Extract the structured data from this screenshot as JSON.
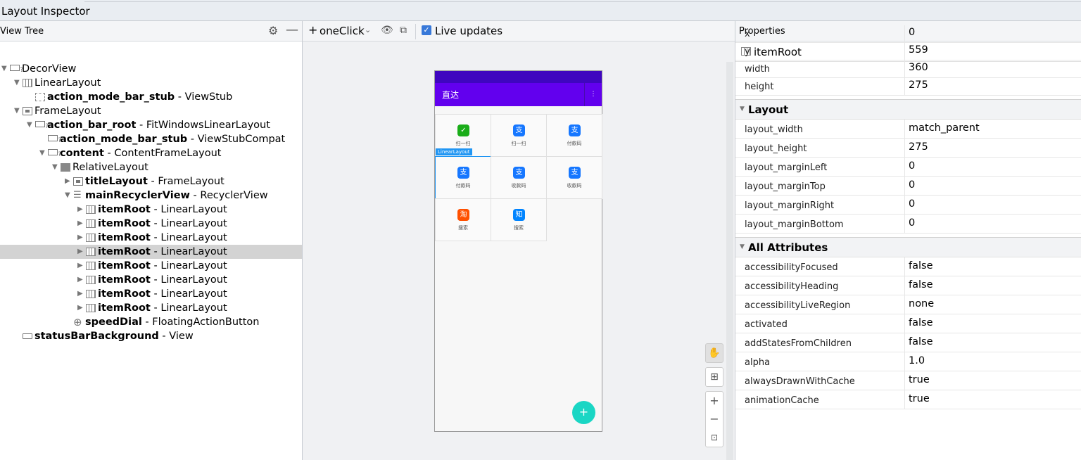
{
  "window": {
    "title": "Layout Inspector"
  },
  "view_tree": {
    "header": "View Tree",
    "gear_icon": "gear-icon",
    "minimize_icon": "minimize-icon",
    "nodes": [
      {
        "id": "",
        "cls": "DecorView"
      },
      {
        "id": "",
        "cls": "LinearLayout"
      },
      {
        "id": "action_mode_bar_stub",
        "cls": "ViewStub"
      },
      {
        "id": "",
        "cls": "FrameLayout"
      },
      {
        "id": "action_bar_root",
        "cls": "FitWindowsLinearLayout"
      },
      {
        "id": "action_mode_bar_stub",
        "cls": "ViewStubCompat"
      },
      {
        "id": "content",
        "cls": "ContentFrameLayout"
      },
      {
        "id": "",
        "cls": "RelativeLayout"
      },
      {
        "id": "titleLayout",
        "cls": "FrameLayout"
      },
      {
        "id": "mainRecyclerView",
        "cls": "RecyclerView"
      },
      {
        "id": "itemRoot",
        "cls": "LinearLayout"
      },
      {
        "id": "itemRoot",
        "cls": "LinearLayout"
      },
      {
        "id": "itemRoot",
        "cls": "LinearLayout"
      },
      {
        "id": "itemRoot",
        "cls": "LinearLayout"
      },
      {
        "id": "itemRoot",
        "cls": "LinearLayout"
      },
      {
        "id": "itemRoot",
        "cls": "LinearLayout"
      },
      {
        "id": "itemRoot",
        "cls": "LinearLayout"
      },
      {
        "id": "itemRoot",
        "cls": "LinearLayout"
      },
      {
        "id": "speedDial",
        "cls": "FloatingActionButton"
      },
      {
        "id": "statusBarBackground",
        "cls": "View"
      }
    ],
    "separator": " - "
  },
  "toolbar": {
    "plus": "+",
    "process": "oneClick",
    "dropdown": "⌄",
    "live_updates": "Live updates",
    "checkmark": "✓"
  },
  "device": {
    "app_title": "直达",
    "menu": "⋮",
    "selected_tag": "LinearLayout",
    "fab": "+",
    "cells": [
      {
        "icon": "✓",
        "caption": "扫一扫",
        "color": "#1aad19"
      },
      {
        "icon": "支",
        "caption": "扫一扫",
        "color": "#1677ff"
      },
      {
        "icon": "支",
        "caption": "付款码",
        "color": "#1677ff"
      },
      {
        "icon": "支",
        "caption": "付款码",
        "color": "#1677ff"
      },
      {
        "icon": "支",
        "caption": "收款码",
        "color": "#1677ff"
      },
      {
        "icon": "支",
        "caption": "收款码",
        "color": "#1677ff"
      },
      {
        "icon": "淘",
        "caption": "搜索",
        "color": "#ff5000"
      },
      {
        "icon": "知",
        "caption": "搜索",
        "color": "#0084ff"
      }
    ]
  },
  "zoom": {
    "pan": "✋",
    "fit": "⊞",
    "in": "+",
    "out": "−",
    "actual": "⊡"
  },
  "properties": {
    "header": "Properties",
    "view_name": "itemRoot",
    "basic": [
      {
        "k": "x",
        "v": "0"
      },
      {
        "k": "y",
        "v": "559"
      },
      {
        "k": "width",
        "v": "360"
      },
      {
        "k": "height",
        "v": "275"
      }
    ],
    "layout_title": "Layout",
    "layout": [
      {
        "k": "layout_width",
        "v": "match_parent"
      },
      {
        "k": "layout_height",
        "v": "275"
      },
      {
        "k": "layout_marginLeft",
        "v": "0"
      },
      {
        "k": "layout_marginTop",
        "v": "0"
      },
      {
        "k": "layout_marginRight",
        "v": "0"
      },
      {
        "k": "layout_marginBottom",
        "v": "0"
      }
    ],
    "all_title": "All Attributes",
    "all": [
      {
        "k": "accessibilityFocused",
        "v": "false"
      },
      {
        "k": "accessibilityHeading",
        "v": "false"
      },
      {
        "k": "accessibilityLiveRegion",
        "v": "none"
      },
      {
        "k": "activated",
        "v": "false"
      },
      {
        "k": "addStatesFromChildren",
        "v": "false"
      },
      {
        "k": "alpha",
        "v": "1.0"
      },
      {
        "k": "alwaysDrawnWithCache",
        "v": "true"
      },
      {
        "k": "animationCache",
        "v": "true"
      }
    ]
  }
}
